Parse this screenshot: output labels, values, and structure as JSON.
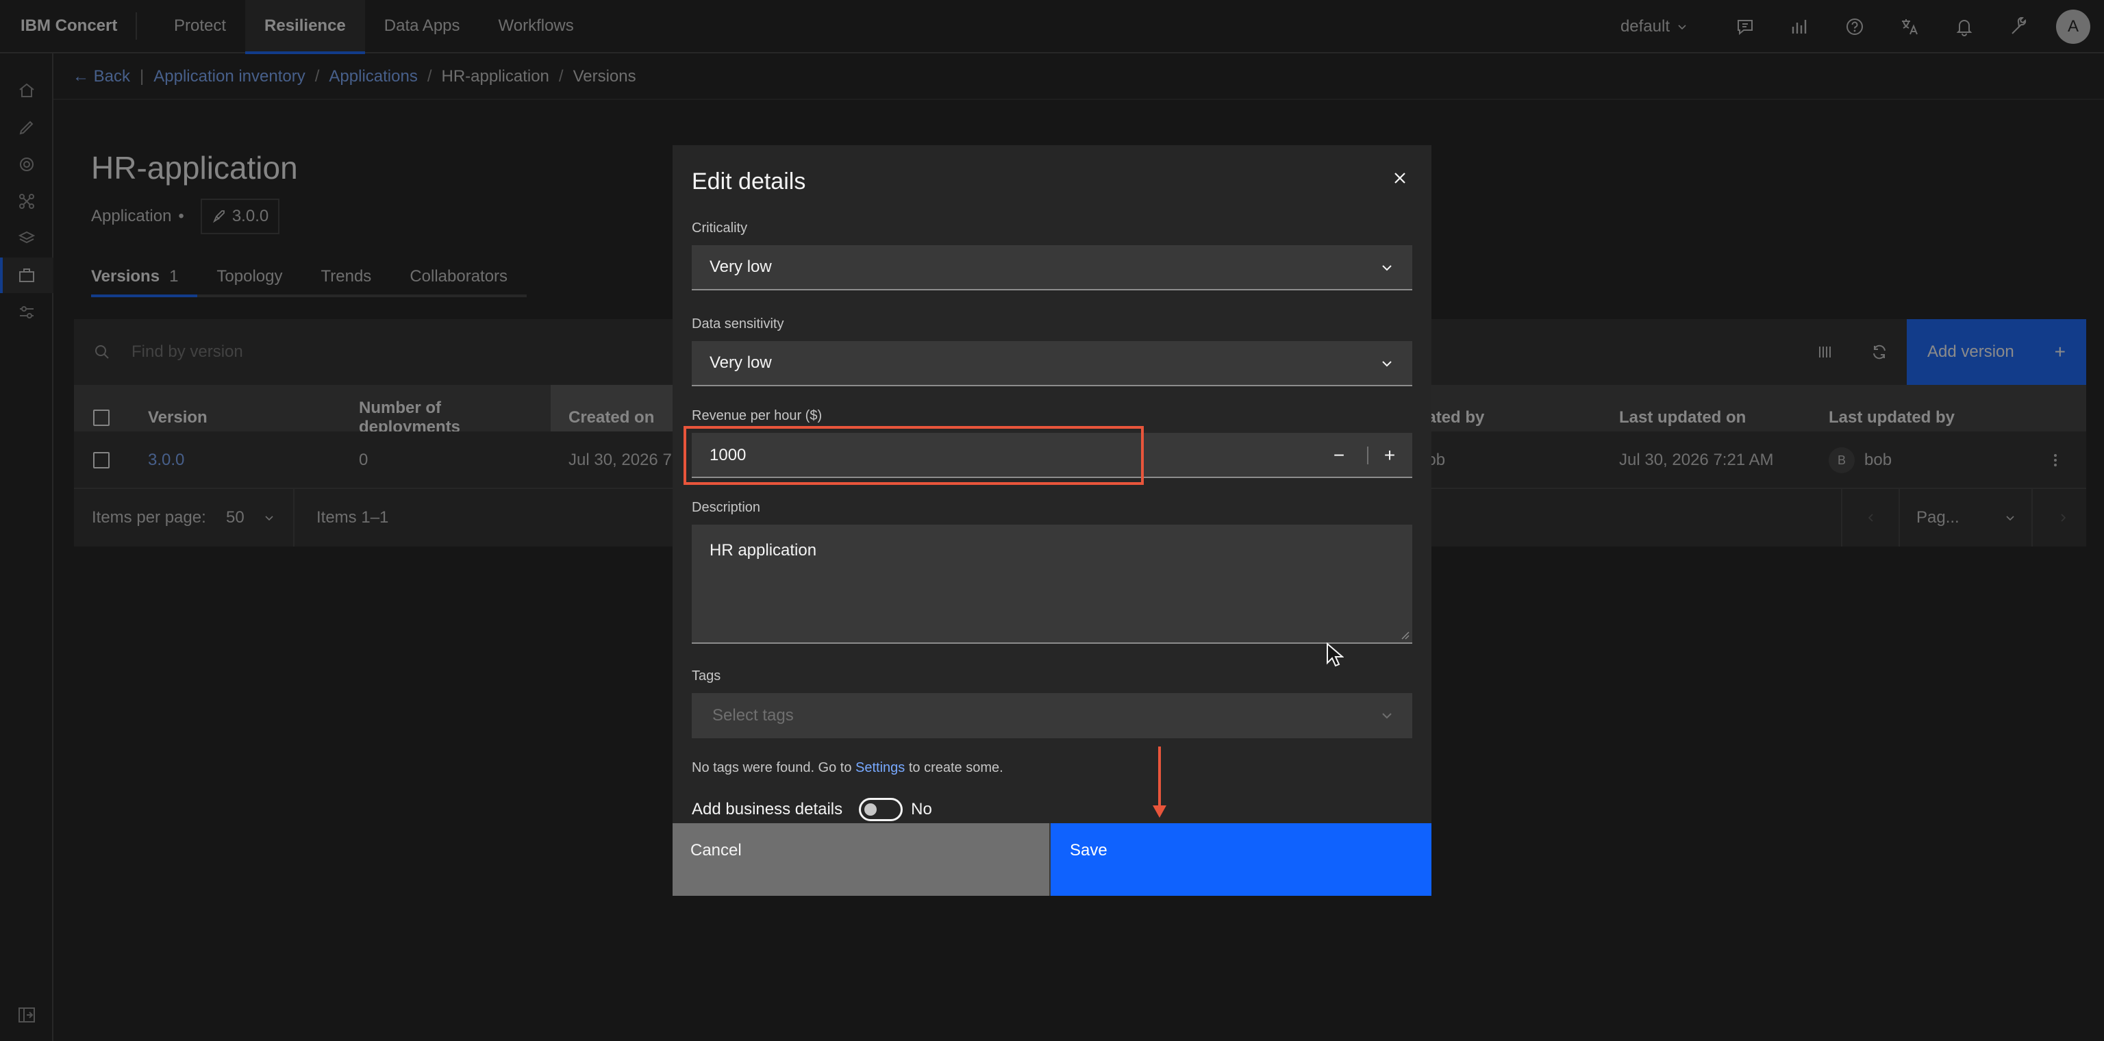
{
  "header": {
    "brand": "IBM Concert",
    "nav": [
      "Protect",
      "Resilience",
      "Data Apps",
      "Workflows"
    ],
    "tenant": "default"
  },
  "breadcrumb": {
    "back": "← Back",
    "items": [
      "Application inventory",
      "Applications",
      "HR-application",
      "Versions"
    ]
  },
  "page": {
    "title": "HR-application",
    "type": "Application",
    "version_tag": "3.0.0",
    "tabs": [
      {
        "label": "Versions",
        "count": "1"
      },
      {
        "label": "Topology"
      },
      {
        "label": "Trends"
      },
      {
        "label": "Collaborators"
      }
    ]
  },
  "table": {
    "search_placeholder": "Find by version",
    "add_label": "Add version",
    "headers": {
      "version": "Version",
      "deployments_1": "Number of",
      "deployments_2": "deployments",
      "created_on": "Created on",
      "created_by": "eated by",
      "updated_on": "Last updated on",
      "updated_by": "Last updated by"
    },
    "rows": [
      {
        "version": "3.0.0",
        "deployments": "0",
        "created_on": "Jul 30, 2026 7",
        "created_by": "bob",
        "updated_on": "Jul 30, 2026 7:21 AM",
        "updated_by_initial": "B",
        "updated_by": "bob"
      }
    ],
    "pagination": {
      "items_per_page_label": "Items per page:",
      "per_page": "50",
      "range": "Items 1–1",
      "page_select": "Pag..."
    }
  },
  "modal": {
    "title": "Edit details",
    "criticality": {
      "label": "Criticality",
      "value": "Very low"
    },
    "sensitivity": {
      "label": "Data sensitivity",
      "value": "Very low"
    },
    "revenue": {
      "label": "Revenue per hour ($)",
      "value": "1000"
    },
    "description": {
      "label": "Description",
      "value": "HR application"
    },
    "tags": {
      "label": "Tags",
      "placeholder": "Select tags",
      "helper_pre": "No tags were found. Go to",
      "helper_link": "Settings",
      "helper_post": "to create some."
    },
    "business": {
      "label": "Add business details",
      "state": "No"
    },
    "cancel": "Cancel",
    "save": "Save"
  },
  "colors": {
    "accent": "#0f62fe",
    "highlight": "#e8553b"
  }
}
